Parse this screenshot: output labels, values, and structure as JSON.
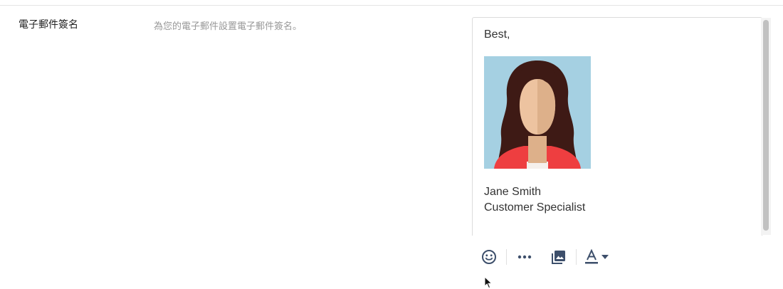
{
  "settings": {
    "signature_label": "電子郵件簽名",
    "signature_hint": "為您的電子郵件設置電子郵件簽名。"
  },
  "editor": {
    "greeting": "Best,",
    "name": "Jane Smith",
    "title": "Customer Specialist"
  },
  "toolbar": {
    "buttons": [
      "smiley-icon",
      "more-icon",
      "image-icon",
      "text-color-icon",
      "caret-down-icon"
    ],
    "icon_color": "#3d4f6b"
  },
  "colors": {
    "avatar_bg": "#a5d0e2",
    "hair": "#3e1a15",
    "skin_light": "#edc3a0",
    "skin_shade": "#ddb08a",
    "shirt": "#ee3e40"
  }
}
